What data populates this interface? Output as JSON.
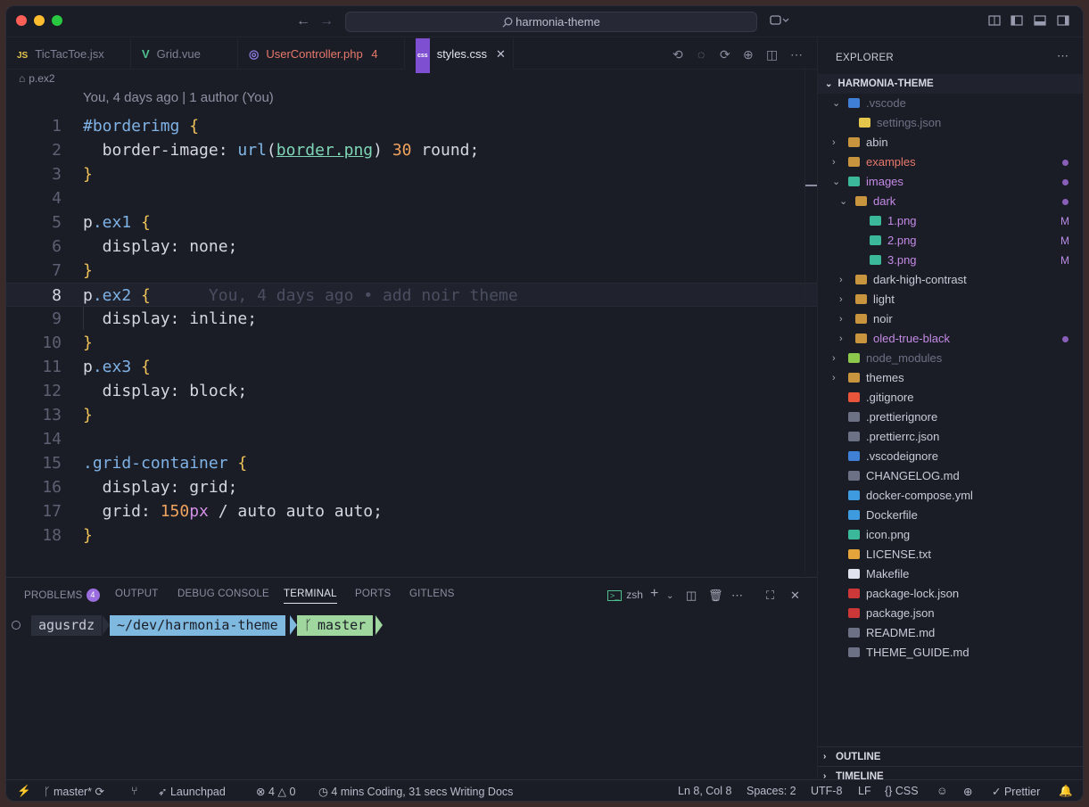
{
  "titlebar": {
    "search_text": "harmonia-theme"
  },
  "tabs": [
    {
      "label": "TicTacToe.jsx",
      "icon": "JS",
      "color": "#7d8194"
    },
    {
      "label": "Grid.vue",
      "icon": "V",
      "color": "#7d8194"
    },
    {
      "label": "UserController.php",
      "badge": "4",
      "icon": "php",
      "color": "#e8786b"
    },
    {
      "label": "styles.css",
      "icon": "css",
      "color": "#e1e3ee"
    }
  ],
  "breadcrumb": {
    "label": "p.ex2"
  },
  "editor": {
    "blame_header": "You, 4 days ago | 1 author (You)",
    "inline_blame": "You, 4 days ago • add noir theme",
    "line_numbers": [
      "1",
      "2",
      "3",
      "4",
      "5",
      "6",
      "7",
      "8",
      "9",
      "10",
      "11",
      "12",
      "13",
      "14",
      "15",
      "16",
      "17",
      "18"
    ],
    "current_line": 8
  },
  "panel": {
    "tabs": [
      "PROBLEMS",
      "OUTPUT",
      "DEBUG CONSOLE",
      "TERMINAL",
      "PORTS",
      "GITLENS"
    ],
    "problems_count": "4",
    "shell": "zsh",
    "prompt_user": "agusrdz",
    "prompt_path": "~/dev/harmonia-theme",
    "prompt_branch": "master"
  },
  "sidebar": {
    "title": "EXPLORER",
    "root": "HARMONIA-THEME",
    "items": [
      {
        "label": ".vscode",
        "color": "#6d7185"
      },
      {
        "label": "settings.json",
        "color": "#6d7185"
      },
      {
        "label": "abin",
        "color": "#c8cad8"
      },
      {
        "label": "examples",
        "color": "#e8786b"
      },
      {
        "label": "images",
        "color": "#c48ae6"
      },
      {
        "label": "dark",
        "color": "#c48ae6"
      },
      {
        "label": "1.png",
        "color": "#c48ae6",
        "flag": "M"
      },
      {
        "label": "2.png",
        "color": "#c48ae6",
        "flag": "M"
      },
      {
        "label": "3.png",
        "color": "#c48ae6",
        "flag": "M"
      },
      {
        "label": "dark-high-contrast",
        "color": "#c8cad8"
      },
      {
        "label": "light",
        "color": "#c8cad8"
      },
      {
        "label": "noir",
        "color": "#c8cad8"
      },
      {
        "label": "oled-true-black",
        "color": "#c48ae6"
      },
      {
        "label": "node_modules",
        "color": "#6d7185"
      },
      {
        "label": "themes",
        "color": "#c8cad8"
      },
      {
        "label": ".gitignore",
        "color": "#c8cad8"
      },
      {
        "label": ".prettierignore",
        "color": "#c8cad8"
      },
      {
        "label": ".prettierrc.json",
        "color": "#c8cad8"
      },
      {
        "label": ".vscodeignore",
        "color": "#c8cad8"
      },
      {
        "label": "CHANGELOG.md",
        "color": "#c8cad8"
      },
      {
        "label": "docker-compose.yml",
        "color": "#c8cad8"
      },
      {
        "label": "Dockerfile",
        "color": "#c8cad8"
      },
      {
        "label": "icon.png",
        "color": "#c8cad8"
      },
      {
        "label": "LICENSE.txt",
        "color": "#c8cad8"
      },
      {
        "label": "Makefile",
        "color": "#c8cad8"
      },
      {
        "label": "package-lock.json",
        "color": "#c8cad8"
      },
      {
        "label": "package.json",
        "color": "#c8cad8"
      },
      {
        "label": "README.md",
        "color": "#c8cad8"
      },
      {
        "label": "THEME_GUIDE.md",
        "color": "#c8cad8"
      }
    ],
    "outline": "OUTLINE",
    "timeline": "TIMELINE"
  },
  "statusbar": {
    "branch": "master*",
    "launchpad": "Launchpad",
    "errors": "4",
    "warnings": "0",
    "wakatime": "4 mins Coding, 31 secs Writing Docs",
    "position": "Ln 8, Col 8",
    "spaces": "Spaces: 2",
    "encoding": "UTF-8",
    "eol": "LF",
    "language": "CSS",
    "formatter": "Prettier"
  }
}
